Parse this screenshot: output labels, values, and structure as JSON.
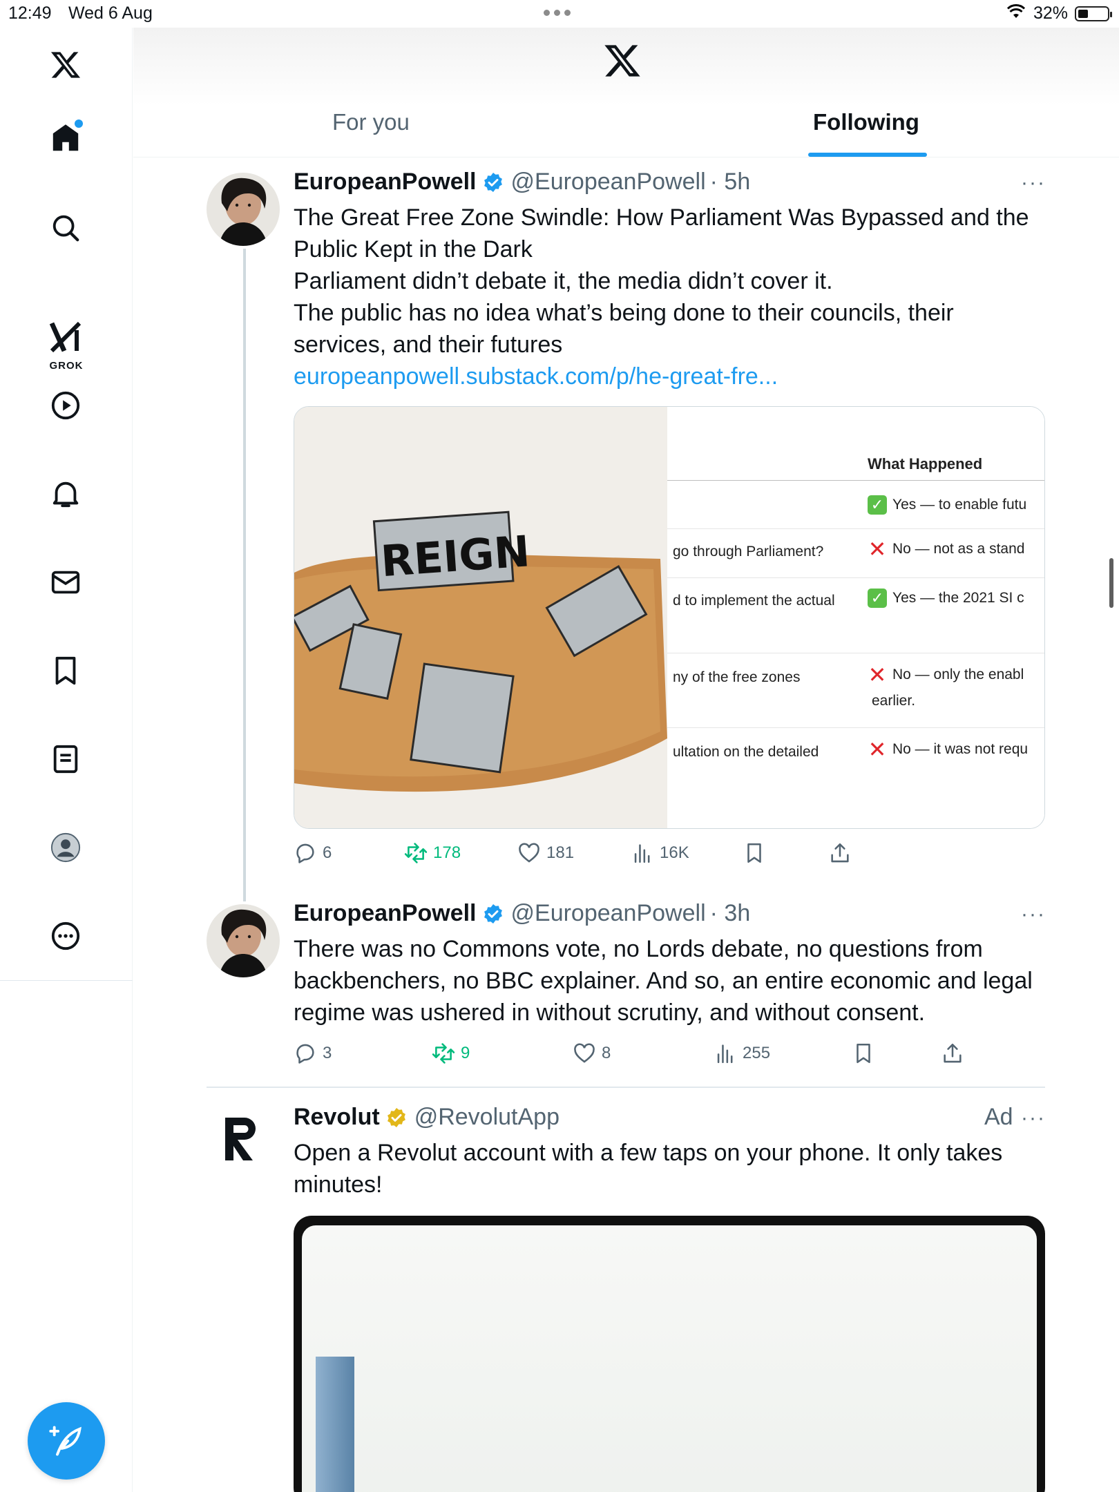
{
  "status_bar": {
    "time": "12:49",
    "date": "Wed 6 Aug",
    "battery": "32%"
  },
  "sidebar": {
    "grok_label": "GROK"
  },
  "header": {
    "tabs": [
      {
        "label": "For you",
        "selected": false
      },
      {
        "label": "Following",
        "selected": true
      }
    ]
  },
  "tweets": [
    {
      "name": "EuropeanPowell",
      "handle": "@EuropeanPowell",
      "time": "· 5h",
      "lines": [
        "The Great Free Zone Swindle: How Parliament Was Bypassed and the Public Kept in the Dark",
        "Parliament didn’t debate it, the media didn’t cover it.",
        "The public has no idea what’s being done to their councils, their services, and their futures"
      ],
      "link": "europeanpowell.substack.com/p/he-great-fre...",
      "media_table": {
        "header": "What Happened",
        "rows": [
          {
            "q": "",
            "a": "Yes — to enable futu",
            "mark": "yes"
          },
          {
            "q": "go through Parliament?",
            "a": "No — not as a stand",
            "mark": "no"
          },
          {
            "q": "d to implement the actual",
            "a": "Yes — the 2021 SI c",
            "mark": "yes"
          },
          {
            "q": "ny of the free zones",
            "a": "No — only the enabl",
            "a2": "earlier.",
            "mark": "no"
          },
          {
            "q": "ultation on the detailed",
            "a": "No — it was not requ",
            "mark": "no"
          }
        ]
      },
      "stats": {
        "replies": "6",
        "reposts": "178",
        "likes": "181",
        "views": "16K"
      }
    },
    {
      "name": "EuropeanPowell",
      "handle": "@EuropeanPowell",
      "time": "· 3h",
      "text": "There was no Commons vote, no Lords debate, no questions from backbenchers, no BBC explainer. And so, an entire economic and legal regime was ushered in without scrutiny, and without consent.",
      "stats": {
        "replies": "3",
        "reposts": "9",
        "likes": "8",
        "views": "255"
      }
    }
  ],
  "ad": {
    "name": "Revolut",
    "handle": "@RevolutApp",
    "label": "Ad",
    "text": "Open a Revolut account with a few taps on your phone. It only takes minutes!"
  },
  "colors": {
    "accent": "#1d9bf0",
    "repost": "#00ba7c",
    "muted": "#536471",
    "text": "#0f1419",
    "gold_verified": "#e2b719"
  }
}
